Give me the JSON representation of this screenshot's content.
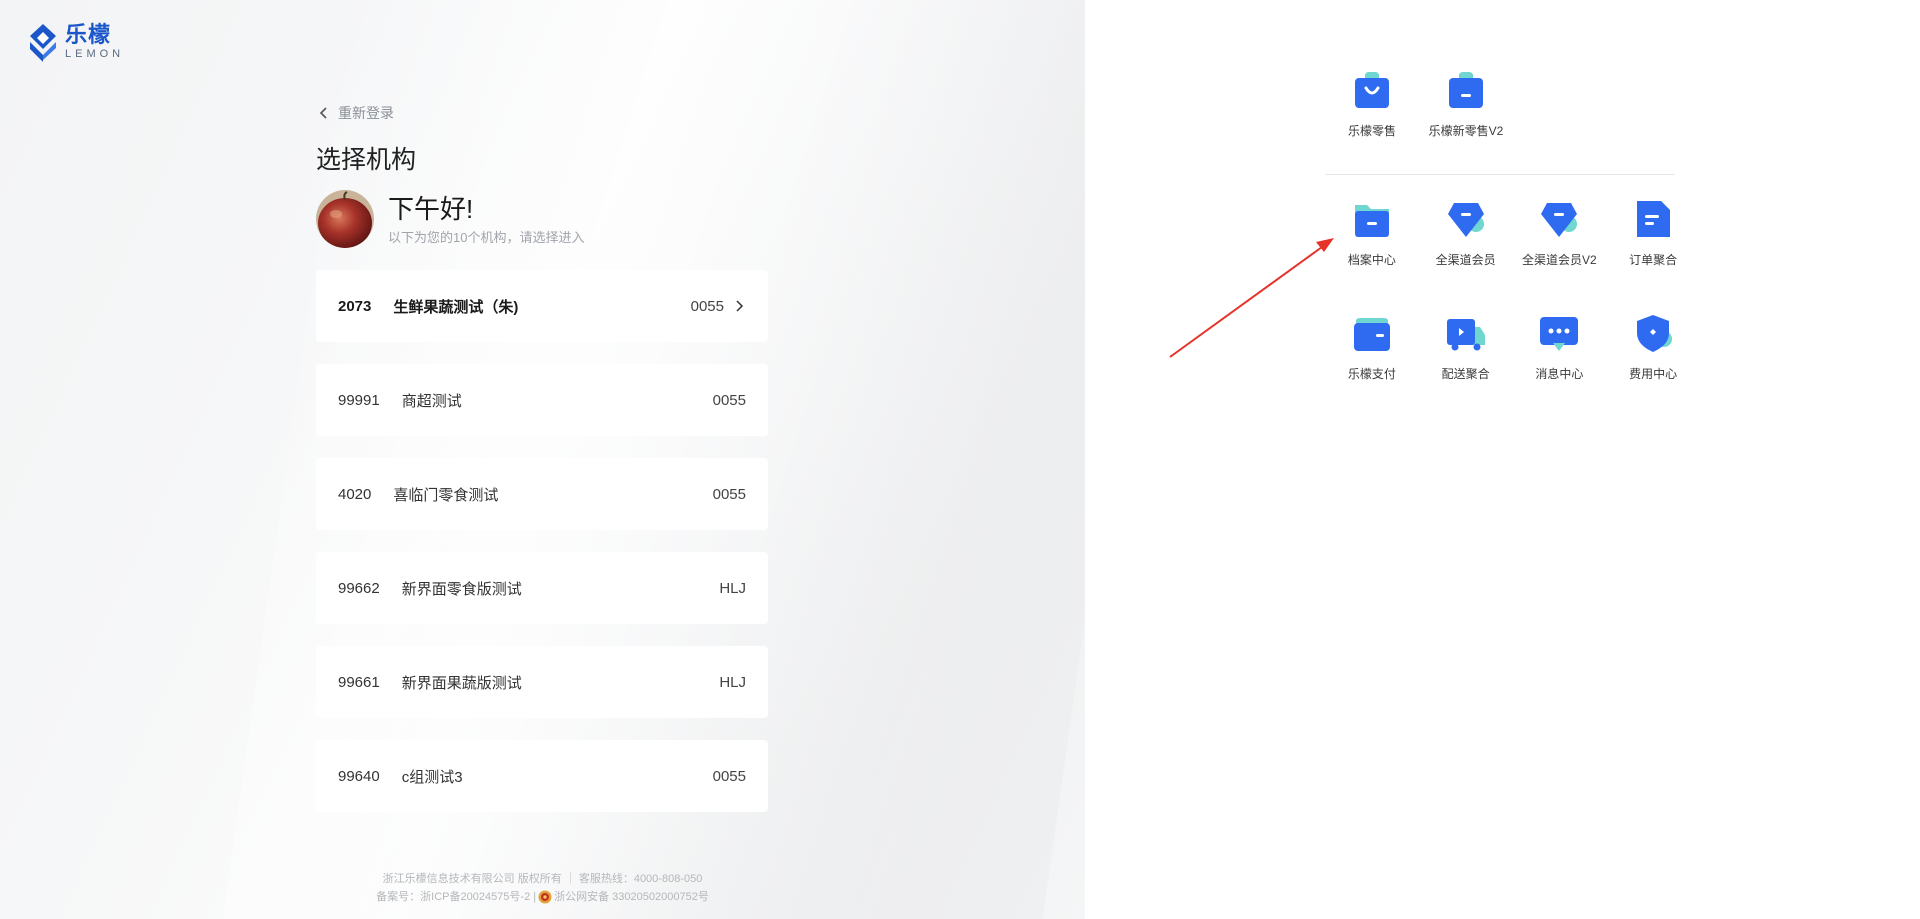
{
  "brand": {
    "name_cn": "乐檬",
    "name_en": "LEMON",
    "accent": "#2f6bf0"
  },
  "nav": {
    "back_label": "重新登录"
  },
  "page": {
    "title": "选择机构"
  },
  "greeting": {
    "title": "下午好!",
    "subtitle": "以下为您的10个机构，请选择进入"
  },
  "orgs": [
    {
      "code": "2073",
      "name": "生鲜果蔬测试（朱)",
      "tag": "0055",
      "active": true
    },
    {
      "code": "99991",
      "name": "商超测试",
      "tag": "0055"
    },
    {
      "code": "4020",
      "name": "喜临门零食测试",
      "tag": "0055"
    },
    {
      "code": "99662",
      "name": "新界面零食版测试",
      "tag": "HLJ"
    },
    {
      "code": "99661",
      "name": "新界面果蔬版测试",
      "tag": "HLJ"
    },
    {
      "code": "99640",
      "name": "c组测试3",
      "tag": "0055"
    }
  ],
  "footer": {
    "line1": "浙江乐檬信息技术有限公司 版权所有 ｜ 客服热线：4000-808-050",
    "line2a": "备案号：浙ICP备20024575号-2 |",
    "line2b": "浙公网安备 33020502000752号"
  },
  "apps": {
    "group1": [
      {
        "label": "乐檬零售",
        "icon": "shopping-bag-icon"
      },
      {
        "label": "乐檬新零售V2",
        "icon": "shopping-bag-icon"
      }
    ],
    "group2": [
      {
        "label": "档案中心",
        "icon": "folder-icon"
      },
      {
        "label": "全渠道会员",
        "icon": "diamond-icon"
      },
      {
        "label": "全渠道会员V2",
        "icon": "diamond-icon"
      },
      {
        "label": "订单聚合",
        "icon": "document-icon"
      }
    ],
    "group3": [
      {
        "label": "乐檬支付",
        "icon": "wallet-icon"
      },
      {
        "label": "配送聚合",
        "icon": "truck-icon"
      },
      {
        "label": "消息中心",
        "icon": "message-icon"
      },
      {
        "label": "费用中心",
        "icon": "shield-icon"
      }
    ]
  },
  "colors": {
    "icon_blue": "#2f6bf0",
    "icon_teal": "#6fd6d0",
    "annotation_arrow": "#e5332a"
  }
}
